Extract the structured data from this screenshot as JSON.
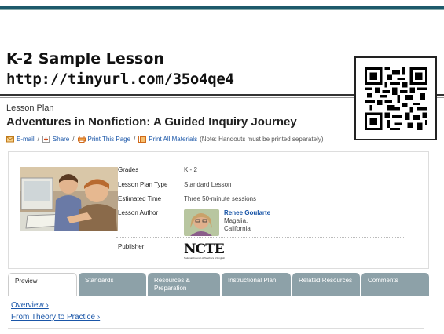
{
  "slide": {
    "title": "K-2 Sample Lesson",
    "url": "http://tinyurl.com/35o4qe4"
  },
  "page": {
    "kind": "Lesson Plan",
    "title": "Adventures in Nonfiction: A Guided Inquiry Journey"
  },
  "actions": {
    "email": "E-mail",
    "share": "Share",
    "print_page": "Print This Page",
    "print_all": "Print All Materials",
    "note": "(Note: Handouts must be printed separately)"
  },
  "meta": {
    "grades_label": "Grades",
    "grades_value": "K - 2",
    "type_label": "Lesson Plan Type",
    "type_value": "Standard Lesson",
    "time_label": "Estimated Time",
    "time_value": "Three 50-minute sessions",
    "author_label": "Lesson Author",
    "author_name": "Renee Goularte",
    "author_city": "Magalia,",
    "author_state": "California",
    "publisher_label": "Publisher",
    "publisher_logo": "NCTE",
    "publisher_tagline": "National Council of Teachers of English"
  },
  "tabs": [
    {
      "label": "Preview"
    },
    {
      "label": "Standards"
    },
    {
      "label": "Resources &",
      "label2": "Preparation"
    },
    {
      "label": "Instructional Plan"
    },
    {
      "label": "Related Resources"
    },
    {
      "label": "Comments"
    }
  ],
  "links": {
    "overview": "Overview ›",
    "theory": "From Theory to Practice ›"
  },
  "colors": {
    "link": "#1a56a8",
    "tab_inactive": "#8da1a8",
    "header_rule": "#1d5a6b"
  }
}
